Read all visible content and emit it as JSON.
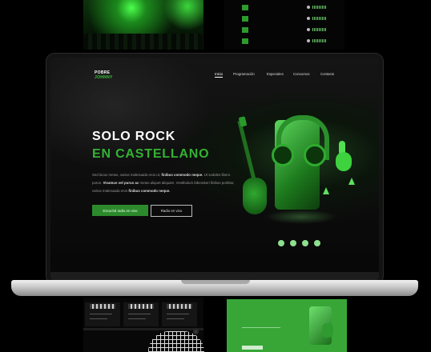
{
  "brand": {
    "line1": "POBRE",
    "line2": "JOHNNY"
  },
  "nav": {
    "items": [
      {
        "label": "Inicio",
        "active": true
      },
      {
        "label": "Programación",
        "active": false
      },
      {
        "label": "Especiales",
        "active": false
      },
      {
        "label": "Concursos",
        "active": false
      },
      {
        "label": "Contacto",
        "active": false
      }
    ]
  },
  "hero": {
    "title_line1": "SOLO ROCK",
    "title_line2": "EN CASTELLANO",
    "para": [
      {
        "text": "Sed lacus metus, varius malesuada eros ut, ",
        "bold": false
      },
      {
        "text": "finibus commodo neque.",
        "bold": true
      },
      {
        "text": " Ut sodales libero purus. ",
        "bold": false
      },
      {
        "text": "Vivamus vel purus ac",
        "bold": true
      },
      {
        "text": " metus aliquet aliquam. Vestibulum bibendum finibus porttitor, varius malesuada eros ",
        "bold": false
      },
      {
        "text": "finibus commodo neque.",
        "bold": true
      }
    ],
    "btn_primary": "Escuchá radio en vivo",
    "btn_secondary": "Radio en vivo"
  },
  "social_icons": [
    "facebook-icon",
    "instagram-icon",
    "tiktok-icon",
    "youtube-icon"
  ],
  "colors": {
    "accent": "#33b233",
    "accent_dark": "#2c8a2c",
    "background": "#0a0a0a"
  }
}
